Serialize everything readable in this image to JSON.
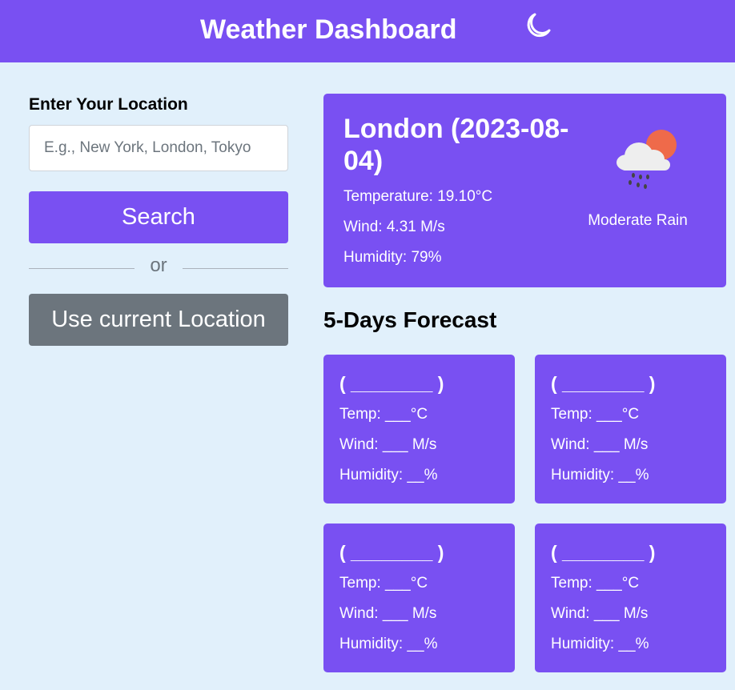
{
  "header": {
    "title": "Weather Dashboard",
    "theme_icon": "moon-icon"
  },
  "sidebar": {
    "location_label": "Enter Your Location",
    "search_placeholder": "E.g., New York, London, Tokyo",
    "search_value": "",
    "search_button": "Search",
    "divider_text": "or",
    "current_location_button": "Use current Location"
  },
  "current": {
    "city": "London (2023-08-04)",
    "temperature": "Temperature: 19.10°C",
    "wind": "Wind: 4.31 M/s",
    "humidity": "Humidity: 79%",
    "condition": "Moderate Rain",
    "icon": "cloud-rain-sun-icon"
  },
  "forecast": {
    "title": "5-Days Forecast",
    "days": [
      {
        "date": "( ________ )",
        "temp": "Temp: ___°C",
        "wind": "Wind: ___ M/s",
        "humidity": "Humidity: __%"
      },
      {
        "date": "( ________ )",
        "temp": "Temp: ___°C",
        "wind": "Wind: ___ M/s",
        "humidity": "Humidity: __%"
      },
      {
        "date": "( ________ )",
        "temp": "Temp: ___°C",
        "wind": "Wind: ___ M/s",
        "humidity": "Humidity: __%"
      },
      {
        "date": "( ________ )",
        "temp": "Temp: ___°C",
        "wind": "Wind: ___ M/s",
        "humidity": "Humidity: __%"
      }
    ]
  },
  "colors": {
    "primary": "#7950f2",
    "secondary": "#6c757d",
    "background": "#e1f0fb"
  }
}
